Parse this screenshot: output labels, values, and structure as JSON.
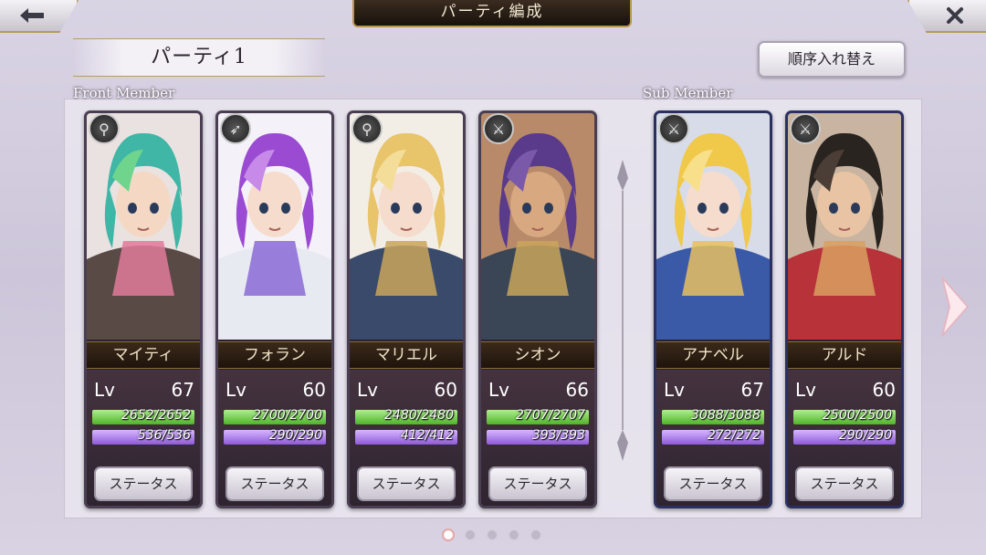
{
  "header": {
    "title": "パーティ編成",
    "party_name": "パーティ1",
    "sort_label": "順序入れ替え"
  },
  "sections": {
    "front": "Front Member",
    "sub": "Sub Member"
  },
  "level_label": "Lv",
  "status_label": "ステータス",
  "members": [
    {
      "name": "マイティ",
      "lv": "67",
      "hp": "2652/2652",
      "mp": "536/536",
      "role": "key-icon"
    },
    {
      "name": "フォラン",
      "lv": "60",
      "hp": "2700/2700",
      "mp": "290/290",
      "role": "arrow-icon"
    },
    {
      "name": "マリエル",
      "lv": "60",
      "hp": "2480/2480",
      "mp": "412/412",
      "role": "key-icon"
    },
    {
      "name": "シオン",
      "lv": "66",
      "hp": "2707/2707",
      "mp": "393/393",
      "role": "sword-icon"
    },
    {
      "name": "アナベル",
      "lv": "67",
      "hp": "3088/3088",
      "mp": "272/272",
      "role": "sword-icon"
    },
    {
      "name": "アルド",
      "lv": "60",
      "hp": "2500/2500",
      "mp": "290/290",
      "role": "sword-icon"
    }
  ],
  "pagination": {
    "pages": 5,
    "current": 1
  },
  "colors": {
    "hp": "#6fcc44",
    "mp": "#a779ea",
    "gold": "#b8964c"
  }
}
